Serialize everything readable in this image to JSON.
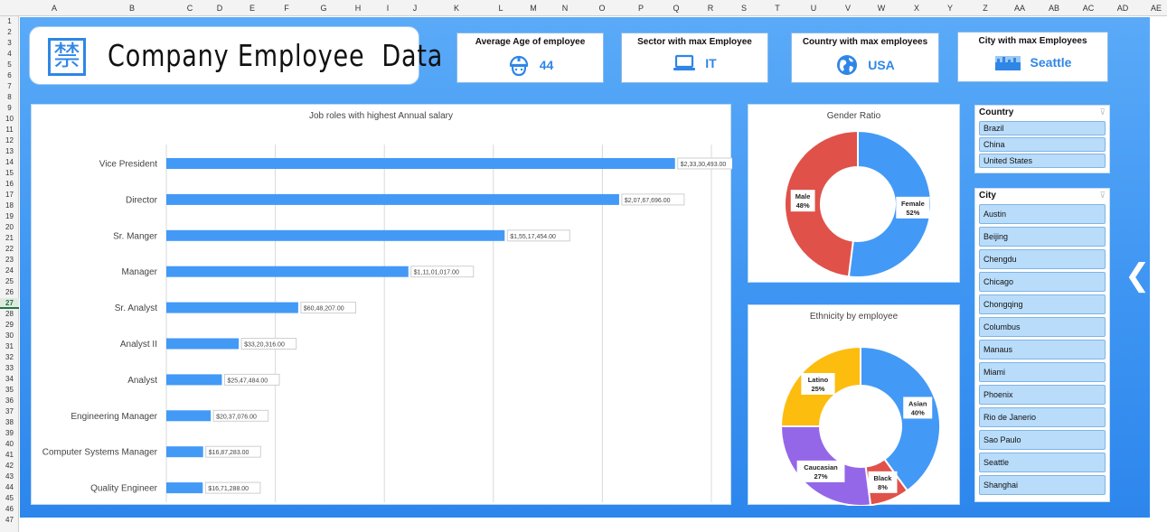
{
  "sheet": {
    "columns": [
      "A",
      "B",
      "C",
      "D",
      "E",
      "F",
      "G",
      "H",
      "I",
      "J",
      "K",
      "L",
      "M",
      "N",
      "O",
      "P",
      "Q",
      "R",
      "S",
      "T",
      "U",
      "V",
      "W",
      "X",
      "Y",
      "Z",
      "AA",
      "AB",
      "AC",
      "AD",
      "AE"
    ],
    "rows": [
      "1",
      "2",
      "3",
      "4",
      "5",
      "6",
      "7",
      "8",
      "9",
      "10",
      "11",
      "12",
      "13",
      "14",
      "15",
      "16",
      "17",
      "18",
      "19",
      "20",
      "21",
      "22",
      "23",
      "24",
      "25",
      "26",
      "27",
      "28",
      "29",
      "30",
      "31",
      "32",
      "33",
      "34",
      "35",
      "36",
      "37",
      "38",
      "39",
      "40",
      "41",
      "42",
      "43",
      "44",
      "45",
      "46",
      "47"
    ],
    "active_row": "27"
  },
  "header": {
    "logo_glyph": "禁",
    "title": "Company Employee  Data"
  },
  "kpis": [
    {
      "title": "Average Age of employee",
      "value": "44",
      "icon": "worker-helmet-icon"
    },
    {
      "title": "Sector with max Employee",
      "value": "IT",
      "icon": "laptop-icon"
    },
    {
      "title": "Country with max employees",
      "value": "USA",
      "icon": "globe-icon"
    },
    {
      "title": "City with max Employees",
      "value": "Seattle",
      "icon": "city-skyline-icon"
    }
  ],
  "colors": {
    "accent": "#2f86e6",
    "bar": "#4399f6",
    "female": "#4399f6",
    "male": "#e0514a",
    "asian": "#4399f6",
    "black": "#e0514a",
    "caucasian": "#9467e8",
    "latino": "#fcbd0f"
  },
  "chart_data": [
    {
      "type": "bar",
      "title": "Job roles with highest Annual salary",
      "categories": [
        "Vice President",
        "Director",
        "Sr. Manger",
        "Manager",
        "Sr. Analyst",
        "Analyst II",
        "Analyst",
        "Engineering Manager",
        "Computer Systems Manager",
        "Quality Engineer"
      ],
      "values": [
        233304930,
        207676960,
        155174540,
        111010170,
        60482070,
        33203160,
        25474840,
        20370760,
        16872830,
        16712880
      ],
      "labels": [
        "$2,33,30,493.00",
        "$2,07,67,696.00",
        "$1,55,17,454.00",
        "$1,11,01,017.00",
        "$60,48,207.00",
        "$33,20,316.00",
        "$25,47,484.00",
        "$20,37,076.00",
        "$16,87,283.00",
        "$16,71,288.00"
      ],
      "xlim": [
        0,
        250000000
      ],
      "grid": true
    },
    {
      "type": "pie",
      "title": "Gender Ratio",
      "categories": [
        "Female",
        "Male"
      ],
      "values": [
        52,
        48
      ],
      "labels": [
        "Female\n52%",
        "Male\n48%"
      ]
    },
    {
      "type": "pie",
      "title": "Ethnicity by employee",
      "categories": [
        "Asian",
        "Black",
        "Caucasian",
        "Latino"
      ],
      "values": [
        40,
        8,
        27,
        25
      ],
      "labels": [
        "Asian\n40%",
        "Black\n8%",
        "Caucasian\n27%",
        "Latino\n25%"
      ]
    }
  ],
  "slicers": {
    "country": {
      "title": "Country",
      "items": [
        "Brazil",
        "China",
        "United States"
      ]
    },
    "city": {
      "title": "City",
      "items": [
        "Austin",
        "Beijing",
        "Chengdu",
        "Chicago",
        "Chongqing",
        "Columbus",
        "Manaus",
        "Miami",
        "Phoenix",
        "Rio de Janerio",
        "Sao Paulo",
        "Seattle",
        "Shanghai"
      ]
    }
  },
  "nav": {
    "arrow_glyph": "❮"
  }
}
